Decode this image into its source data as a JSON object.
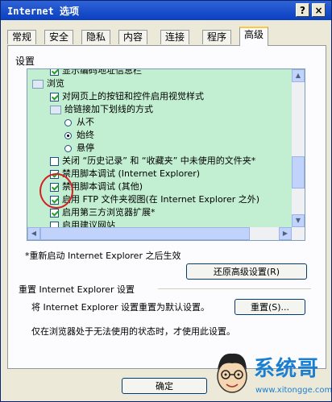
{
  "window": {
    "title": "Internet 选项",
    "help_label": "?",
    "close_label": "×"
  },
  "tabs": [
    {
      "label": "常规"
    },
    {
      "label": "安全"
    },
    {
      "label": "隐私"
    },
    {
      "label": "内容"
    },
    {
      "label": "连接"
    },
    {
      "label": "程序"
    },
    {
      "label": "高级"
    }
  ],
  "settings_label": "设置",
  "items": [
    {
      "label": "显示编码地址信息栏",
      "type": "checkbox",
      "checked": true
    },
    {
      "label": "浏览",
      "type": "folder"
    },
    {
      "label": "对网页上的按钮和控件启用视觉样式",
      "type": "checkbox",
      "checked": true
    },
    {
      "label": "给链接加下划线的方式",
      "type": "folder"
    },
    {
      "label": "从不",
      "type": "radio",
      "checked": false
    },
    {
      "label": "始终",
      "type": "radio",
      "checked": true
    },
    {
      "label": "悬停",
      "type": "radio",
      "checked": false
    },
    {
      "label": "关闭 “历史记录” 和 “收藏夹” 中未使用的文件夹*",
      "type": "checkbox",
      "checked": false
    },
    {
      "label": "禁用脚本调试 (Internet Explorer)",
      "type": "checkbox",
      "checked": true
    },
    {
      "label": "禁用脚本调试 (其他)",
      "type": "checkbox",
      "checked": true
    },
    {
      "label": "启用 FTP 文件夹视图(在 Internet Explorer 之外)",
      "type": "checkbox",
      "checked": true
    },
    {
      "label": "启用第三方浏览器扩展*",
      "type": "checkbox",
      "checked": true
    },
    {
      "label": "启用建议网站",
      "type": "checkbox",
      "checked": false
    }
  ],
  "note": "*重新启动 Internet Explorer 之后生效",
  "restore_button": "还原高级设置(R)",
  "reset_section_title": "重置 Internet Explorer 设置",
  "reset_desc": "将 Internet Explorer 设置重置为默认设置。",
  "reset_button": "重置(S)...",
  "info_text": "仅在浏览器处于无法使用的状态时，才使用此设置。",
  "ok_button": "确定",
  "watermark": {
    "text": "系统哥",
    "url": "www.xitongge.com"
  }
}
